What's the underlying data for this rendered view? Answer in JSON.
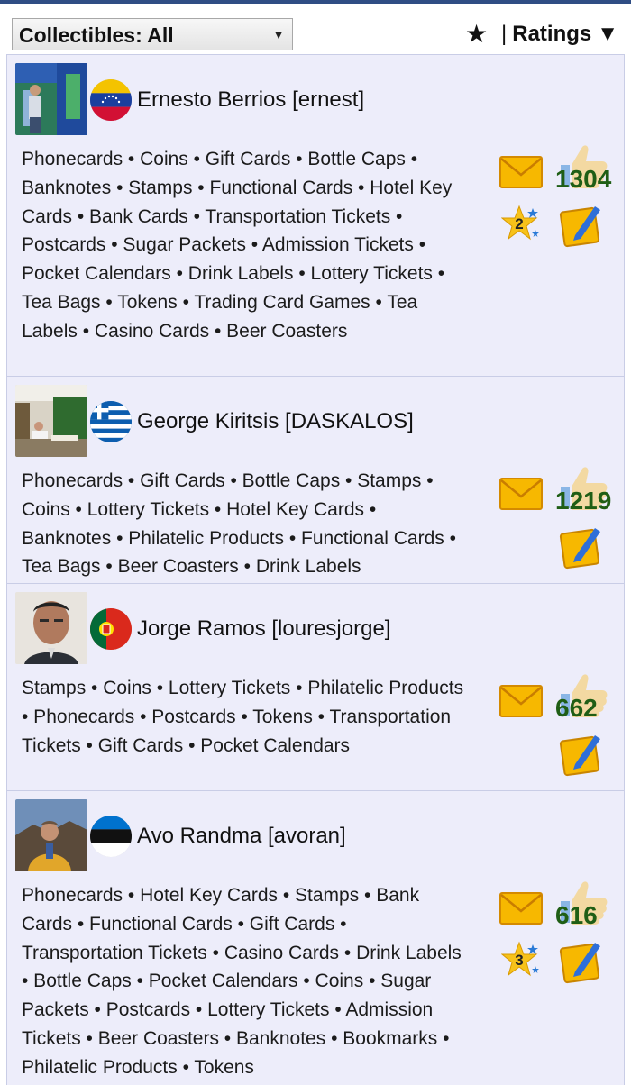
{
  "header": {
    "filter_label": "Collectibles: All",
    "filter_arrow": "▼",
    "star_symbol": "★",
    "separator": "|",
    "ratings_label": "Ratings",
    "ratings_arrow": "▼"
  },
  "members": [
    {
      "name": "Ernesto Berrios [ernest]",
      "country": "Venezuela",
      "collections": "Phonecards • Coins • Gift Cards • Bottle Caps • Banknotes • Stamps • Functional Cards • Hotel Key Cards • Bank Cards • Transportation Tickets • Postcards • Sugar Packets • Admission Tickets • Pocket Calendars • Drink Labels • Lottery Tickets • Tea Bags • Tokens • Trading Card Games • Tea Labels • Casino Cards • Beer Coasters",
      "rating_count": "1304",
      "badge_level": "2"
    },
    {
      "name": "George Kiritsis [DASKALOS]",
      "country": "Greece",
      "collections": "Phonecards • Gift Cards • Bottle Caps • Stamps • Coins • Lottery Tickets • Hotel Key Cards • Banknotes • Philatelic Products • Functional Cards • Tea Bags • Beer Coasters • Drink Labels",
      "rating_count": "1219"
    },
    {
      "name": "Jorge Ramos [louresjorge]",
      "country": "Portugal",
      "collections": "Stamps • Coins • Lottery Tickets • Philatelic Products • Phonecards • Postcards • Tokens • Transportation Tickets • Gift Cards • Pocket Calendars",
      "rating_count": "662"
    },
    {
      "name": "Avo Randma [avoran]",
      "country": "Estonia",
      "collections": "Phonecards • Hotel Key Cards • Stamps • Bank Cards • Functional Cards • Gift Cards • Transportation Tickets • Casino Cards • Drink Labels • Bottle Caps • Pocket Calendars • Coins • Sugar Packets • Postcards • Lottery Tickets • Admission Tickets • Beer Coasters • Banknotes • Bookmarks • Philatelic Products • Tokens",
      "rating_count": "616",
      "badge_level": "3"
    }
  ],
  "colors": {
    "header_line": "#2f4d84",
    "list_bg": "#ededfa",
    "rating_count": "#1f5e15",
    "mail": "#f5b400",
    "thumb": "#f3d9a2",
    "note": "#f5b400"
  }
}
